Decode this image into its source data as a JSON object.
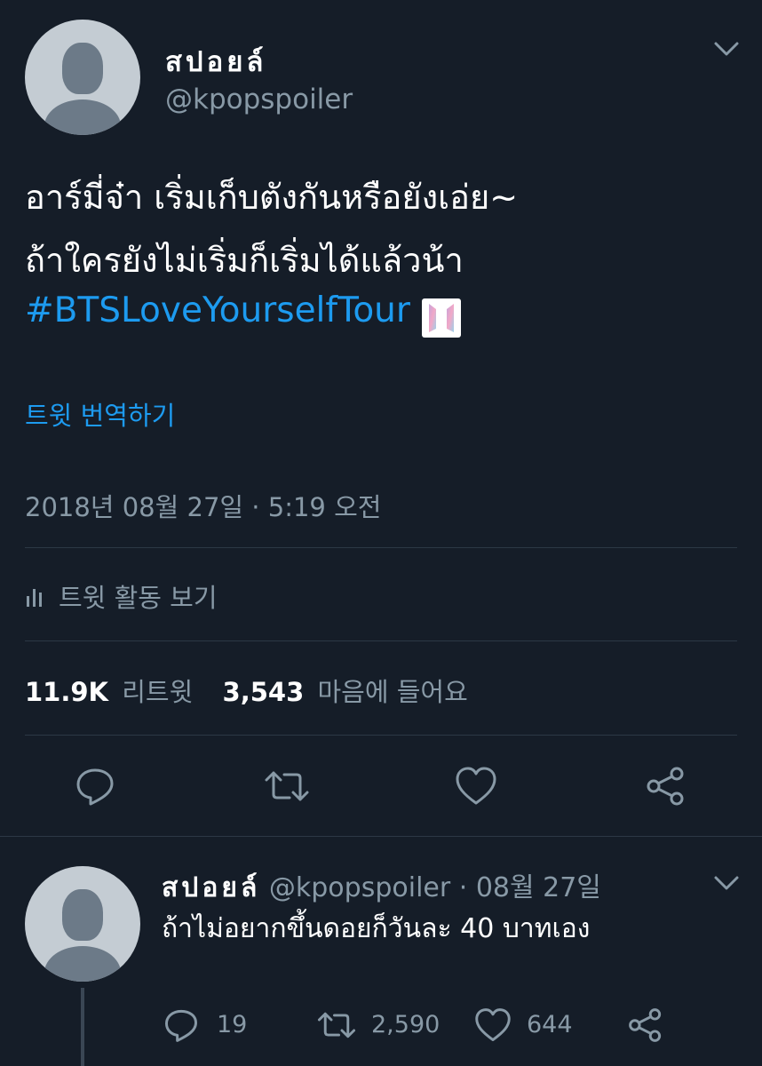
{
  "tweet": {
    "display_name": "สปอยล์",
    "handle": "@kpopspoiler",
    "text_line1": "อาร์มี่จ๋า เริ่มเก็บตังกันหรือยังเอ่ย~",
    "text_line2": "ถ้าใครยังไม่เริ่มก็เริ่มได้แล้วน้า",
    "hashtag": "#BTSLoveYourselfTour",
    "translate_label": "트윗 번역하기",
    "timestamp": "2018년 08월 27일 · 5:19 오전",
    "activity_label": "트윗 활동 보기",
    "retweet_count": "11.9K",
    "retweet_label": "리트윗",
    "like_count": "3,543",
    "like_label": "마음에 들어요"
  },
  "reply": {
    "display_name": "สปอยล์",
    "handle": "@kpopspoiler",
    "date": "· 08월 27일",
    "text": "ถ้าไม่อยากขึ้นดอยก็วันละ 40 บาทเอง",
    "reply_count": "19",
    "retweet_count": "2,590",
    "like_count": "644"
  },
  "colors": {
    "background": "#151d28",
    "link": "#1d9bf0",
    "muted": "#8899a6",
    "divider": "#2c3845"
  },
  "icons": [
    "chevron-down-icon",
    "bar-chart-icon",
    "reply-icon",
    "retweet-icon",
    "heart-icon",
    "share-icon",
    "bts-emoji-icon"
  ]
}
